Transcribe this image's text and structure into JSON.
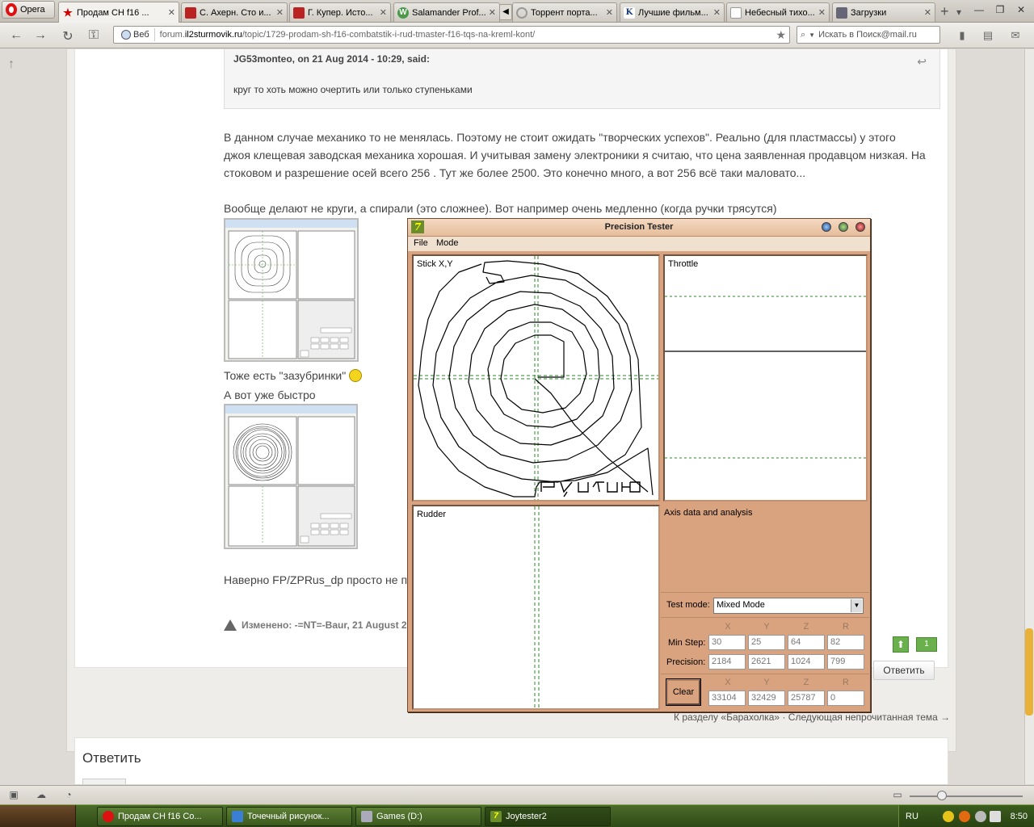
{
  "browser": {
    "opera_label": "Opera",
    "tabs": [
      {
        "label": "Продам CH f16 ...",
        "icon": "star-icon",
        "color": "#c00"
      },
      {
        "label": "С. Ахерн. Сто и...",
        "icon": "bookmark-icon",
        "color": "#b22"
      },
      {
        "label": "Г. Купер. Исто...",
        "icon": "bookmark-icon",
        "color": "#b22"
      },
      {
        "label": "Salamander Prof...",
        "icon": "w-logo-icon",
        "color": "#4a9a4a"
      },
      {
        "label": "Торрент порта...",
        "icon": "loading-icon",
        "color": "#999"
      },
      {
        "label": "Лучшие фильм...",
        "icon": "k-logo-icon",
        "color": "#1a3c7a"
      },
      {
        "label": "Небесный тихо...",
        "icon": "page-icon",
        "color": "#bbb"
      },
      {
        "label": "Загрузки",
        "icon": "downloads-icon",
        "color": "#667"
      }
    ],
    "address": {
      "badge": "Веб",
      "url_prefix": "forum.",
      "url_domain": "il2sturmovik.ru",
      "url_path": "/topic/1729-prodam-sh-f16-combatstik-i-rud-tmaster-f16-tqs-na-kreml-kont/"
    },
    "search_placeholder": "Искать в Поиск@mail.ru"
  },
  "post": {
    "quote_author": "JG53monteo, on 21 Aug 2014 - 10:29, said:",
    "quote_text": "круг то хоть можно очертить или только ступеньками",
    "paragraph1_line1": "В данном случае механико то не менялась. Поэтому не стоит ожидать \"творческих успехов\".  Реально (для пластмассы) у этого",
    "paragraph1_line2": "джоя клещевая заводская механика хорошая. И учитывая замену электроники я считаю, что цена заявленная продавцом низкая. На",
    "paragraph1_line3": "стоковом и разрешение осей всего 256 . Тут же более 2500. Это конечно много, а вот 256 всё таки маловато...",
    "paragraph2": "Вообще делают не круги, а спирали (это сложнее). Вот например очень медленно (когда ручки трясутся)",
    "caption1": "Тоже есть \"зазубринки\"",
    "caption2": "А вот уже быстро",
    "truncated_line": "Наверно FP/ZPRus_dp просто не п",
    "edited": "Изменено: -=NT=-Baur, 21 August 20",
    "rep_count": "1",
    "reply_button": "Ответить",
    "nav_back": "К разделу «Барахолка»",
    "nav_sep": "·",
    "nav_next": "Следующая непрочитанная тема →",
    "reply_heading": "Ответить"
  },
  "joytester": {
    "title": "Precision Tester",
    "menu": [
      "File",
      "Mode"
    ],
    "stick_label": "Stick X,Y",
    "throttle_label": "Throttle",
    "rudder_label": "Rudder",
    "analysis_label": "Axis data and analysis",
    "test_mode_label": "Test mode:",
    "test_mode_value": "Mixed Mode",
    "axes": [
      "X",
      "Y",
      "Z",
      "R"
    ],
    "min_step_label": "Min Step:",
    "min_step": [
      "30",
      "25",
      "64",
      "82"
    ],
    "precision_label": "Precision:",
    "precision": [
      "2184",
      "2621",
      "1024",
      "799"
    ],
    "raw": [
      "33104",
      "32429",
      "25787",
      "0"
    ],
    "clear_label": "Clear",
    "handwritten_word": "РУСЛОН",
    "colors": {
      "frame": "#d8a37e",
      "grid": "#2a8a2a"
    }
  },
  "taskbar": {
    "items": [
      {
        "label": "Продам CH f16 Co...",
        "icon": "opera-icon"
      },
      {
        "label": "Точечный рисунок...",
        "icon": "paint-icon"
      },
      {
        "label": "Games (D:)",
        "icon": "drive-icon"
      },
      {
        "label": "Joytester2",
        "icon": "joytester-icon"
      }
    ],
    "lang": "RU",
    "clock": "8:50"
  }
}
